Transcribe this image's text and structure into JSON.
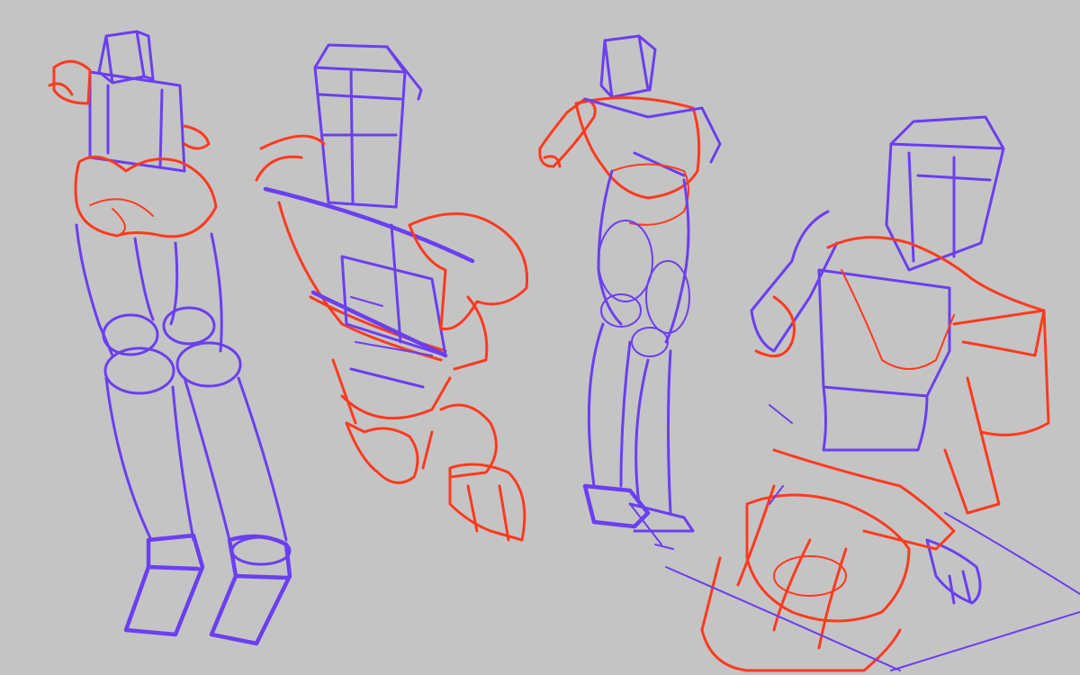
{
  "canvas": {
    "background": "#c4c4c4",
    "stroke_colors": {
      "construction": "#6a3ff0",
      "form": "#ff3a1f"
    }
  },
  "figures": [
    {
      "id": "figure-1",
      "description_visible_text": ""
    },
    {
      "id": "figure-2",
      "description_visible_text": ""
    },
    {
      "id": "figure-3",
      "description_visible_text": ""
    },
    {
      "id": "figure-4",
      "description_visible_text": ""
    }
  ]
}
